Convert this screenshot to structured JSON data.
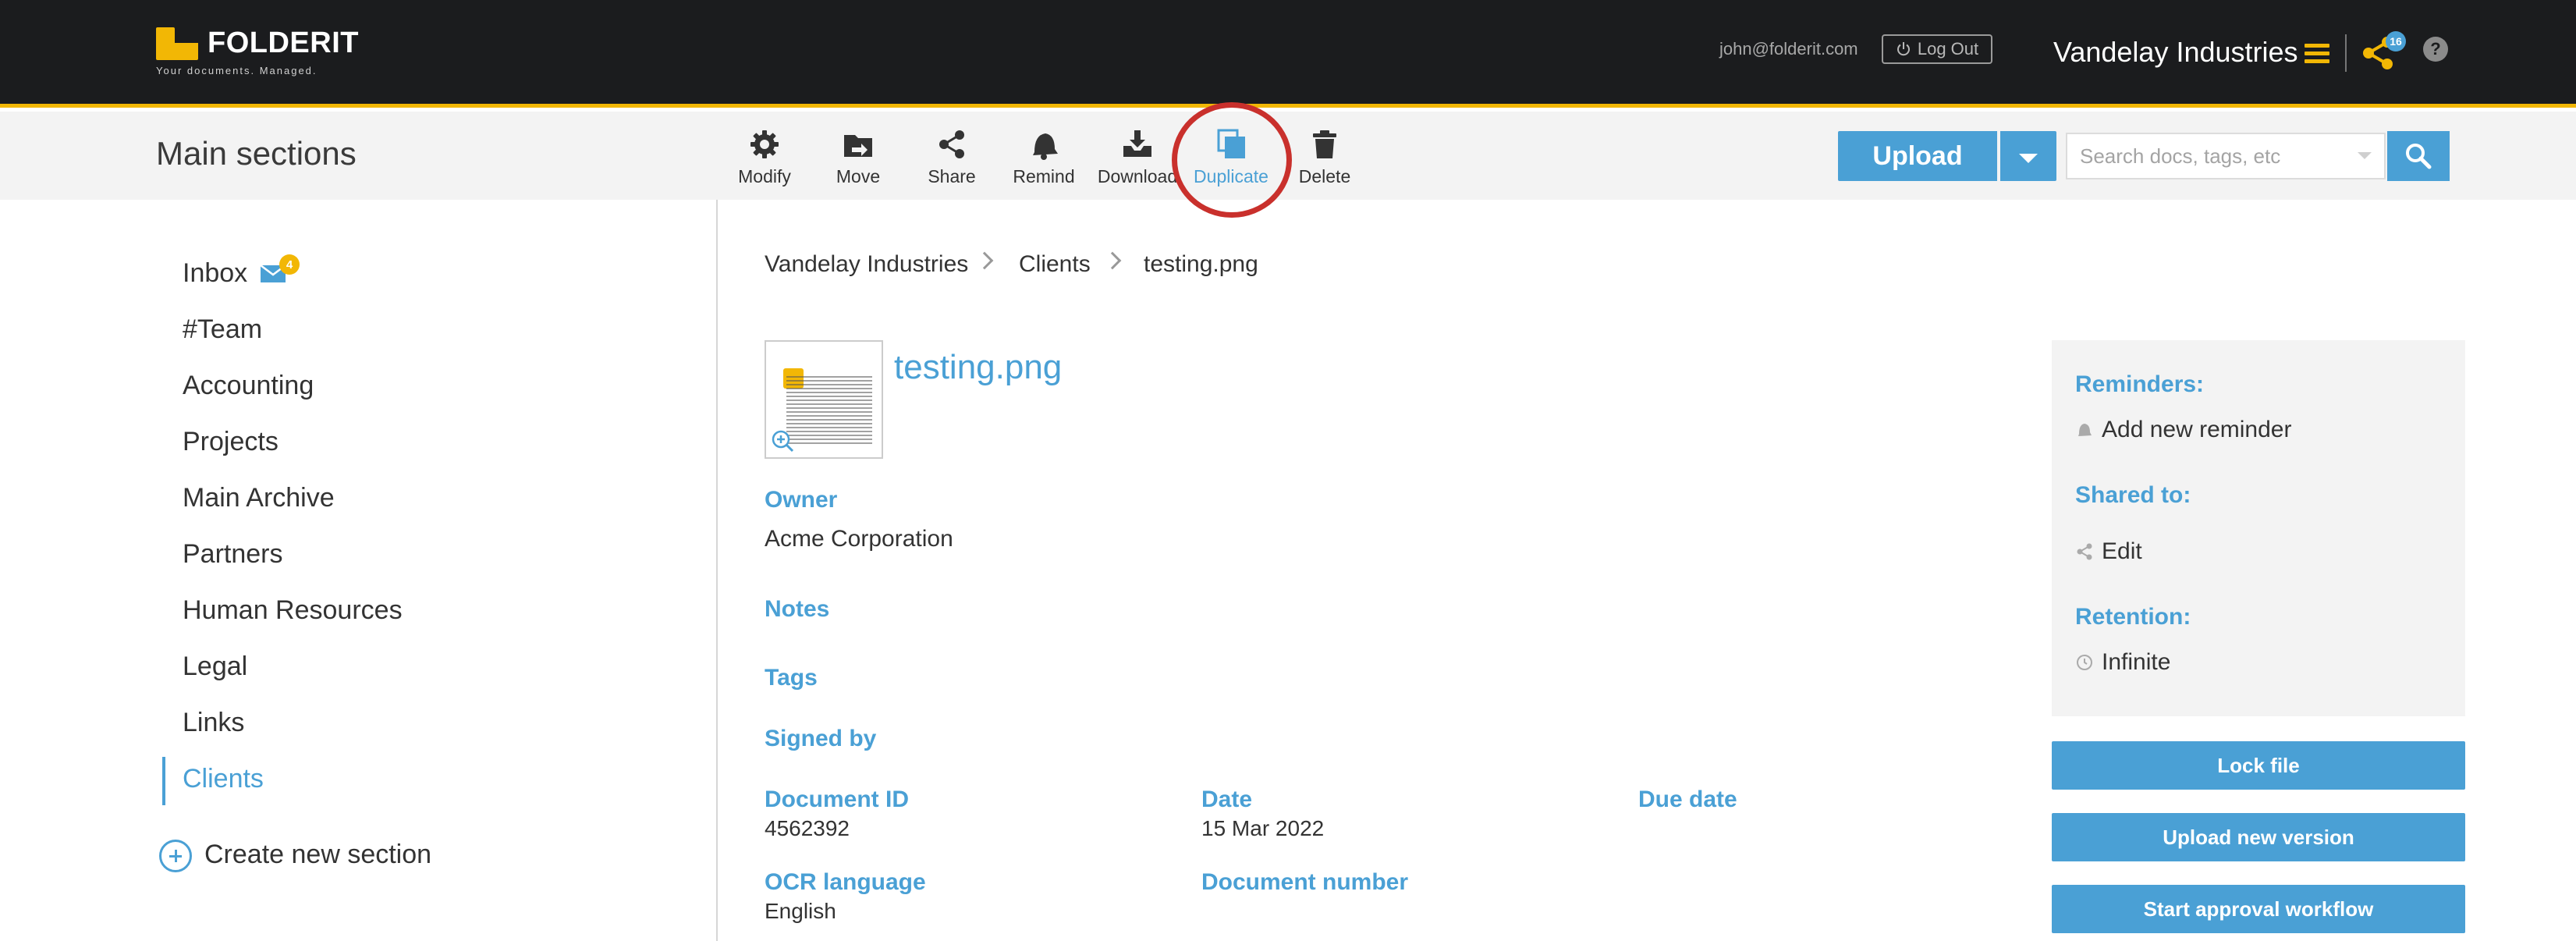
{
  "header": {
    "brand_name": "FOLDERIT",
    "brand_tagline": "Your documents. Managed.",
    "user_email": "john@folderit.com",
    "logout_label": "Log Out",
    "company_name": "Vandelay Industries",
    "share_count": "16",
    "help_label": "?"
  },
  "toolbar": {
    "section_title": "Main sections",
    "tools": [
      {
        "label": "Modify",
        "icon": "gear-icon"
      },
      {
        "label": "Move",
        "icon": "move-folder-icon"
      },
      {
        "label": "Share",
        "icon": "share-icon"
      },
      {
        "label": "Remind",
        "icon": "bell-icon"
      },
      {
        "label": "Download",
        "icon": "download-icon"
      },
      {
        "label": "Duplicate",
        "icon": "duplicate-icon",
        "active": true
      },
      {
        "label": "Delete",
        "icon": "trash-icon"
      }
    ],
    "upload_label": "Upload",
    "search_placeholder": "Search docs, tags, etc"
  },
  "sidebar": {
    "items": [
      {
        "label": "Inbox",
        "badge": "4"
      },
      {
        "label": "#Team"
      },
      {
        "label": "Accounting"
      },
      {
        "label": "Projects"
      },
      {
        "label": "Main Archive"
      },
      {
        "label": "Partners"
      },
      {
        "label": "Human Resources"
      },
      {
        "label": "Legal"
      },
      {
        "label": "Links"
      },
      {
        "label": "Clients",
        "active": true
      }
    ],
    "create_label": "Create new section"
  },
  "breadcrumb": [
    "Vandelay Industries",
    "Clients",
    "testing.png"
  ],
  "document": {
    "file_name": "testing.png",
    "owner_label": "Owner",
    "owner_value": "Acme Corporation",
    "notes_label": "Notes",
    "tags_label": "Tags",
    "signed_by_label": "Signed by",
    "document_id_label": "Document ID",
    "document_id_value": "4562392",
    "date_label": "Date",
    "date_value": "15 Mar 2022",
    "due_date_label": "Due date",
    "ocr_language_label": "OCR language",
    "ocr_language_value": "English",
    "document_number_label": "Document number"
  },
  "panel": {
    "reminders_label": "Reminders:",
    "add_reminder_label": "Add new reminder",
    "shared_to_label": "Shared to:",
    "edit_label": "Edit",
    "retention_label": "Retention:",
    "retention_value": "Infinite"
  },
  "actions": {
    "lock_file": "Lock file",
    "upload_new_version": "Upload new version",
    "start_approval_workflow": "Start approval workflow"
  },
  "colors": {
    "accent": "#4aa0d5",
    "brand_yellow": "#f2b705",
    "topbar": "#1b1c1e",
    "highlight_ring": "#c9302c"
  }
}
